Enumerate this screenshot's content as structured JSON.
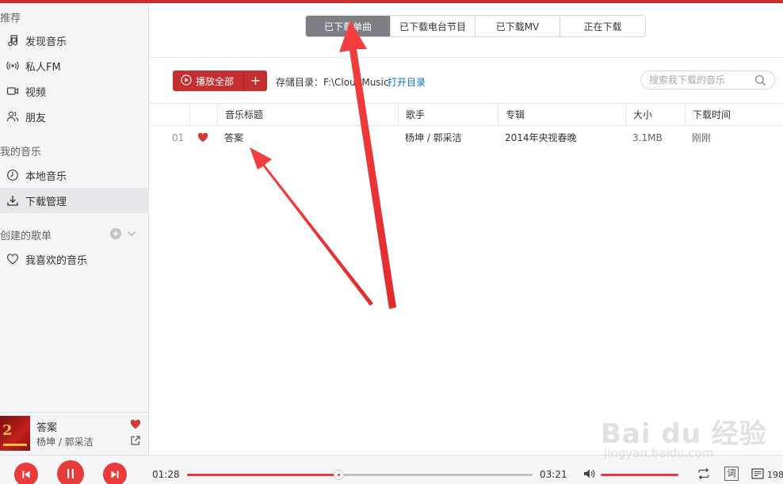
{
  "sidebar": {
    "recommend_title": "推荐",
    "recommend_items": [
      {
        "label": "发现音乐",
        "icon": "music-note-icon"
      },
      {
        "label": "私人FM",
        "icon": "radio-icon"
      },
      {
        "label": "视频",
        "icon": "video-icon"
      },
      {
        "label": "朋友",
        "icon": "friends-icon"
      }
    ],
    "my_music_title": "我的音乐",
    "my_music_items": [
      {
        "label": "本地音乐",
        "icon": "clock-icon"
      },
      {
        "label": "下载管理",
        "icon": "download-icon",
        "active": true
      }
    ],
    "created_playlists_title": "创建的歌单",
    "playlists": [
      {
        "label": "我喜欢的音乐",
        "icon": "heart-outline-icon"
      }
    ]
  },
  "now_playing": {
    "title": "答案",
    "artist": "杨坤 / 郭采洁",
    "liked": true
  },
  "player": {
    "current_time": "01:28",
    "total_time": "03:21",
    "progress_fraction": 0.438,
    "volume_fraction": 1.0,
    "lyric_label": "词",
    "playlist_count": "198"
  },
  "main": {
    "tabs": [
      {
        "label": "已下载单曲",
        "active": true
      },
      {
        "label": "已下载电台节目",
        "active": false
      },
      {
        "label": "已下载MV",
        "active": false
      },
      {
        "label": "正在下载",
        "active": false
      }
    ],
    "play_all_label": "播放全部",
    "add_label": "+",
    "storage_label": "存储目录：F:\\CloudMusic",
    "open_folder_label": "打开目录",
    "search_placeholder": "搜索我下载的音乐",
    "table": {
      "columns": [
        "音乐标题",
        "歌手",
        "专辑",
        "大小",
        "下载时间"
      ],
      "rows": [
        {
          "index": "01",
          "liked": true,
          "title": "答案",
          "artist": "杨坤 / 郭采洁",
          "album": "2014年央视春晚",
          "size": "3.1MB",
          "time": "刚刚"
        }
      ]
    }
  },
  "colors": {
    "brand_red": "#c62f2f",
    "control_red": "#e83c3c",
    "active_tab": "#7c7d85",
    "link_blue": "#0c73c2",
    "annotation_red": "#f03838"
  },
  "watermark": {
    "brand": "Bai du 经验",
    "url": "jingyan.baidu.com"
  }
}
